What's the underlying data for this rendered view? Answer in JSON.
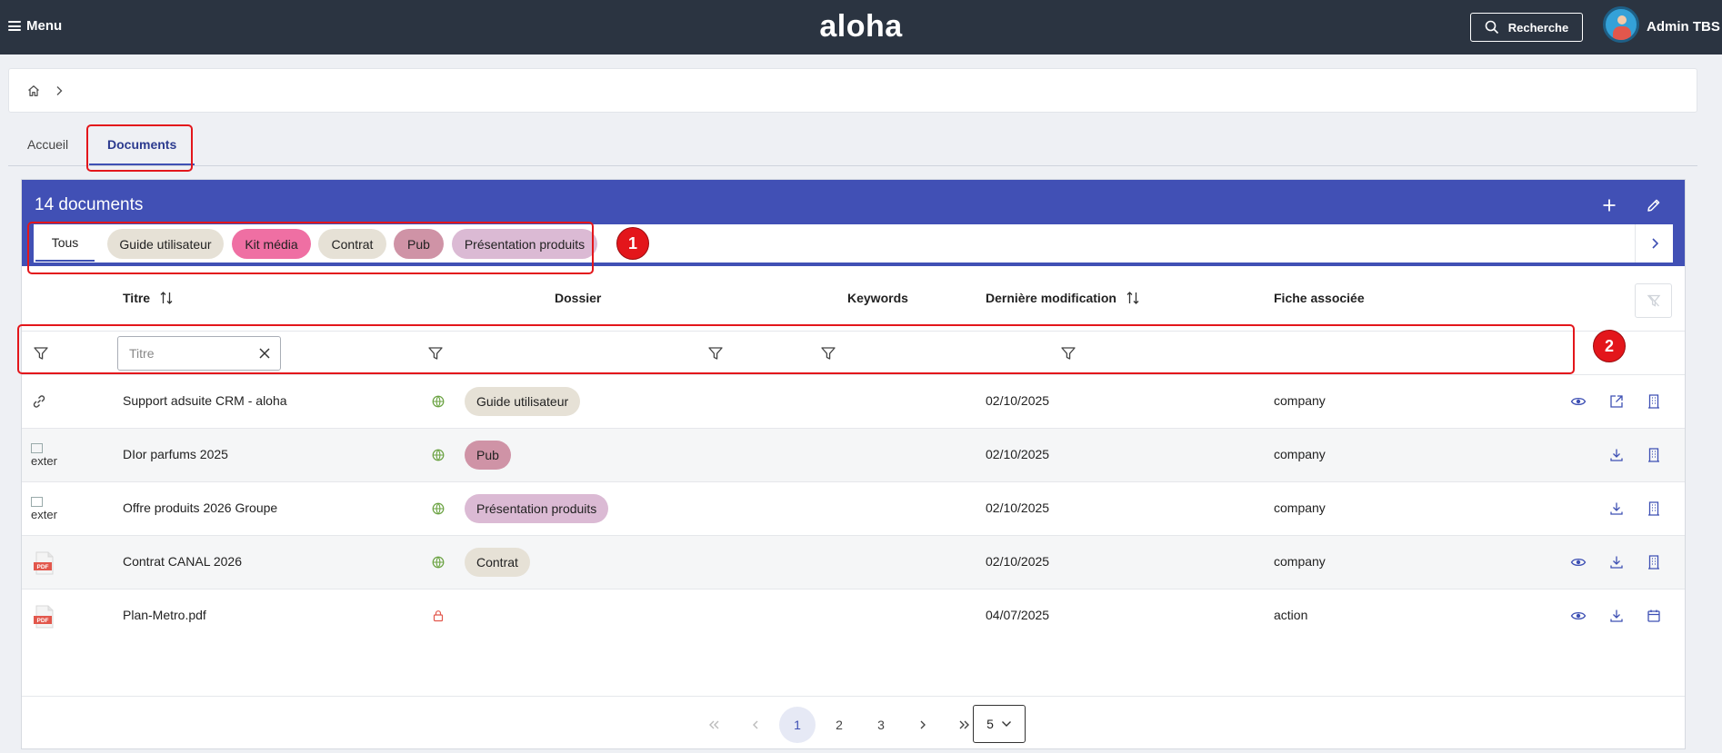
{
  "header": {
    "menu_label": "Menu",
    "logo": "aloha",
    "search_label": "Recherche",
    "user_name": "Admin TBS"
  },
  "breadcrumb": {
    "separator": "›"
  },
  "tabs": [
    {
      "label": "Accueil"
    },
    {
      "label": "Documents",
      "active": true
    }
  ],
  "annotations": [
    "1",
    "2"
  ],
  "panel": {
    "title": "14 documents",
    "chips": [
      {
        "label": "Tous",
        "active": true
      },
      {
        "label": "Guide utilisateur",
        "color": "#e6e1d6"
      },
      {
        "label": "Kit média",
        "color": "#ef6fa3"
      },
      {
        "label": "Contrat",
        "color": "#e6e1d6"
      },
      {
        "label": "Pub",
        "color": "#cf93a6"
      },
      {
        "label": "Présentation produits",
        "color": "#dbbad4"
      }
    ]
  },
  "table": {
    "columns": {
      "titre": "Titre",
      "dossier": "Dossier",
      "keywords": "Keywords",
      "modif": "Dernière modification",
      "fiche": "Fiche associée"
    },
    "filter_placeholder": "Titre",
    "broken_image_alt": "exter",
    "rows": [
      {
        "type": "link-icon",
        "title": "Support adsuite CRM - aloha",
        "status": "globe-icon",
        "tag": "Guide utilisateur",
        "tag_color": "#e6e1d6",
        "date": "02/10/2025",
        "fiche": "company",
        "actions": [
          "eye-icon",
          "external-link-icon",
          "building-icon"
        ]
      },
      {
        "type": "broken-image",
        "title": "DIor parfums 2025",
        "status": "globe-icon",
        "tag": "Pub",
        "tag_color": "#cf93a6",
        "date": "02/10/2025",
        "fiche": "company",
        "actions": [
          "download-icon",
          "building-icon"
        ]
      },
      {
        "type": "broken-image",
        "title": "Offre produits 2026 Groupe",
        "status": "globe-icon",
        "tag": "Présentation produits",
        "tag_color": "#dbbad4",
        "date": "02/10/2025",
        "fiche": "company",
        "actions": [
          "download-icon",
          "building-icon"
        ]
      },
      {
        "type": "pdf-icon",
        "title": "Contrat CANAL 2026",
        "status": "globe-icon",
        "tag": "Contrat",
        "tag_color": "#e6e1d6",
        "date": "02/10/2025",
        "fiche": "company",
        "actions": [
          "eye-icon",
          "download-icon",
          "building-icon"
        ]
      },
      {
        "type": "pdf-icon",
        "title": "Plan-Metro.pdf",
        "status": "lock-icon",
        "tag": "",
        "date": "04/07/2025",
        "fiche": "action",
        "actions": [
          "eye-icon",
          "download-icon",
          "calendar-icon"
        ]
      }
    ]
  },
  "pagination": {
    "pages": [
      "1",
      "2",
      "3"
    ],
    "current": "1",
    "page_size": "5"
  },
  "colors": {
    "topbar": "#2b3441",
    "accent": "#4150b5",
    "annotation": "#e3161b"
  }
}
